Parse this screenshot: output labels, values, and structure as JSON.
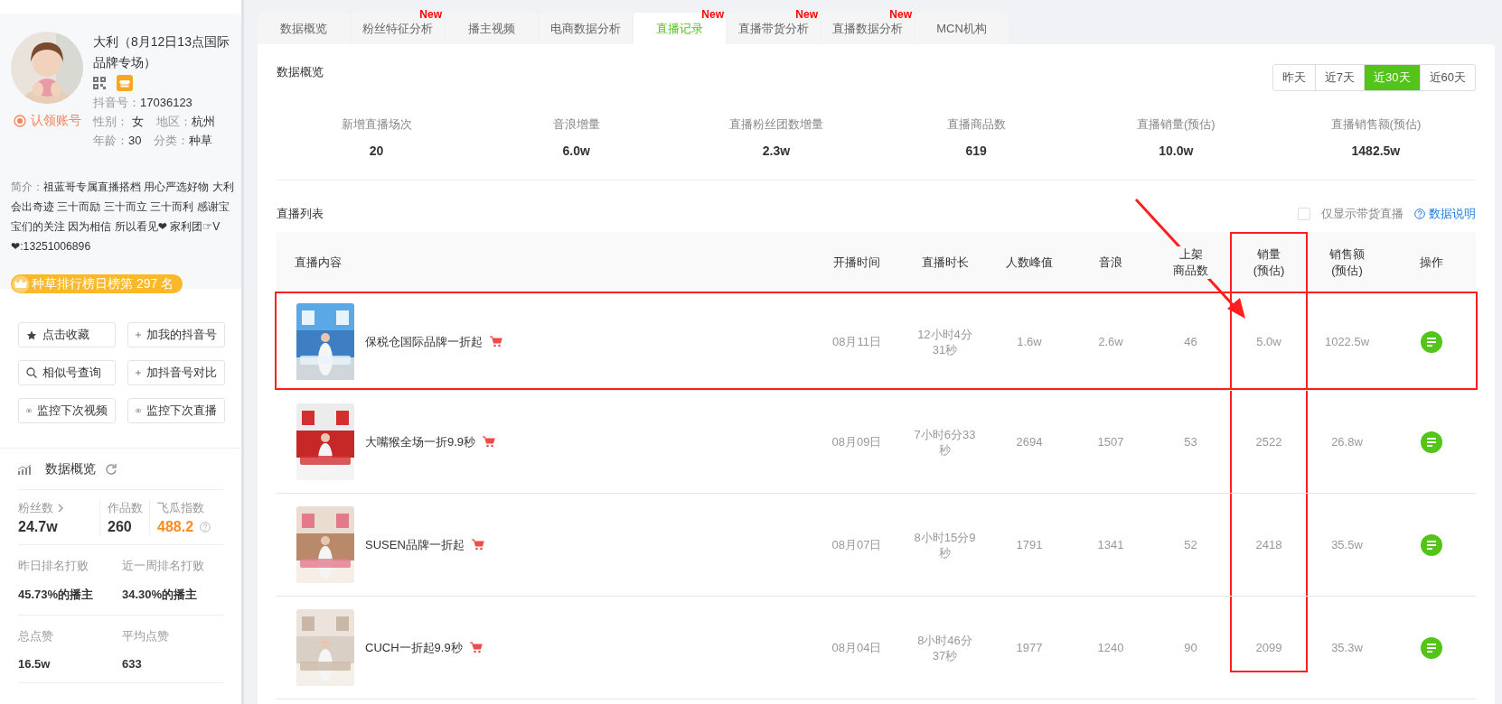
{
  "profile": {
    "name": "大利（8月12日13点国际品牌专场）",
    "claim_label": "认领账号",
    "id_label": "抖音号：",
    "id": "17036123",
    "gender_label": "性别：",
    "gender": "女",
    "region_label": "地区：",
    "region": "杭州",
    "age_label": "年龄：",
    "age": "30",
    "category_label": "分类：",
    "category": "种草",
    "bio_label": "简介：",
    "bio": "祖蓝哥专属直播搭档 用心严选好物 大利会出奇迹 三十而励 三十而立 三十而利 感谢宝宝们的关注 因为相信 所以看见❤ 家利团☞V❤:13251006896",
    "rank_badge": "种草排行榜日榜第 297 名"
  },
  "actions": [
    {
      "kind": "star",
      "label": "点击收藏"
    },
    {
      "kind": "plus",
      "label": "加我的抖音号"
    },
    {
      "kind": "search",
      "label": "相似号查询"
    },
    {
      "kind": "plus",
      "label": "加抖音号对比"
    },
    {
      "kind": "eye",
      "label": "监控下次视频"
    },
    {
      "kind": "eye",
      "label": "监控下次直播"
    }
  ],
  "side_overview": {
    "title": "数据概览",
    "stats": [
      {
        "label": "粉丝数",
        "value": "24.7w",
        "link": true,
        "accent": false,
        "help": false
      },
      {
        "label": "作品数",
        "value": "260",
        "link": false,
        "accent": false,
        "help": false
      },
      {
        "label": "飞瓜指数",
        "value": "488.2",
        "link": false,
        "accent": true,
        "help": true
      }
    ],
    "metrics": [
      {
        "label": "昨日排名打败",
        "value": "45.73%的播主"
      },
      {
        "label": "近一周排名打败",
        "value": "34.30%的播主"
      },
      {
        "label": "总点赞",
        "value": "16.5w"
      },
      {
        "label": "平均点赞",
        "value": "633"
      }
    ]
  },
  "tabs": [
    {
      "label": "数据概览",
      "selected": false
    },
    {
      "label": "粉丝特征分析",
      "selected": false,
      "badge": "New"
    },
    {
      "label": "播主视频",
      "selected": false
    },
    {
      "label": "电商数据分析",
      "selected": false
    },
    {
      "label": "直播记录",
      "selected": true,
      "badge": "New"
    },
    {
      "label": "直播带货分析",
      "selected": false,
      "badge": "New"
    },
    {
      "label": "直播数据分析",
      "selected": false,
      "badge": "New"
    },
    {
      "label": "MCN机构",
      "selected": false
    }
  ],
  "overview": {
    "title": "数据概览",
    "ranges": [
      {
        "label": "昨天",
        "selected": false
      },
      {
        "label": "近7天",
        "selected": false
      },
      {
        "label": "近30天",
        "selected": true
      },
      {
        "label": "近60天",
        "selected": false
      }
    ],
    "stats": [
      {
        "label": "新增直播场次",
        "value": "20"
      },
      {
        "label": "音浪增量",
        "value": "6.0w"
      },
      {
        "label": "直播粉丝团数增量",
        "value": "2.3w"
      },
      {
        "label": "直播商品数",
        "value": "619"
      },
      {
        "label": "直播销量(预估)",
        "value": "10.0w"
      },
      {
        "label": "直播销售额(预估)",
        "value": "1482.5w"
      }
    ]
  },
  "live_list": {
    "title": "直播列表",
    "filter": {
      "label": "仅显示带货直播",
      "checked": false
    },
    "help_link": "数据说明",
    "columns": [
      {
        "lines": [
          "直播内容"
        ],
        "highlighted": false
      },
      {
        "lines": [
          "开播时间"
        ],
        "highlighted": false
      },
      {
        "lines": [
          "直播时长"
        ],
        "highlighted": false
      },
      {
        "lines": [
          "人数峰值"
        ],
        "highlighted": false
      },
      {
        "lines": [
          "音浪"
        ],
        "highlighted": false
      },
      {
        "lines": [
          "上架",
          "商品数"
        ],
        "highlighted": false
      },
      {
        "lines": [
          "销量",
          "(预估)"
        ],
        "highlighted": true
      },
      {
        "lines": [
          "销售额",
          "(预估)"
        ],
        "highlighted": false
      },
      {
        "lines": [
          "操作"
        ],
        "highlighted": false
      }
    ],
    "rows": [
      {
        "title": "保税仓国际品牌一折起",
        "cart": true,
        "date": "08月11日",
        "duration": "12小时4分31秒",
        "peak": "1.6w",
        "yinlang": "2.6w",
        "products": "46",
        "sales": "5.0w",
        "revenue": "1022.5w",
        "highlighted": true
      },
      {
        "title": "大嘴猴全场一折9.9秒",
        "cart": true,
        "date": "08月09日",
        "duration": "7小时6分33秒",
        "peak": "2694",
        "yinlang": "1507",
        "products": "53",
        "sales": "2522",
        "revenue": "26.8w",
        "highlighted": false
      },
      {
        "title": "SUSEN品牌一折起",
        "cart": true,
        "date": "08月07日",
        "duration": "8小时15分9秒",
        "peak": "1791",
        "yinlang": "1341",
        "products": "52",
        "sales": "2418",
        "revenue": "35.5w",
        "highlighted": false
      },
      {
        "title": "CUCH一折起9.9秒",
        "cart": true,
        "date": "08月04日",
        "duration": "8小时46分37秒",
        "peak": "1977",
        "yinlang": "1240",
        "products": "90",
        "sales": "2099",
        "revenue": "35.3w",
        "highlighted": false
      }
    ]
  },
  "annotation": {
    "arrow": true
  }
}
